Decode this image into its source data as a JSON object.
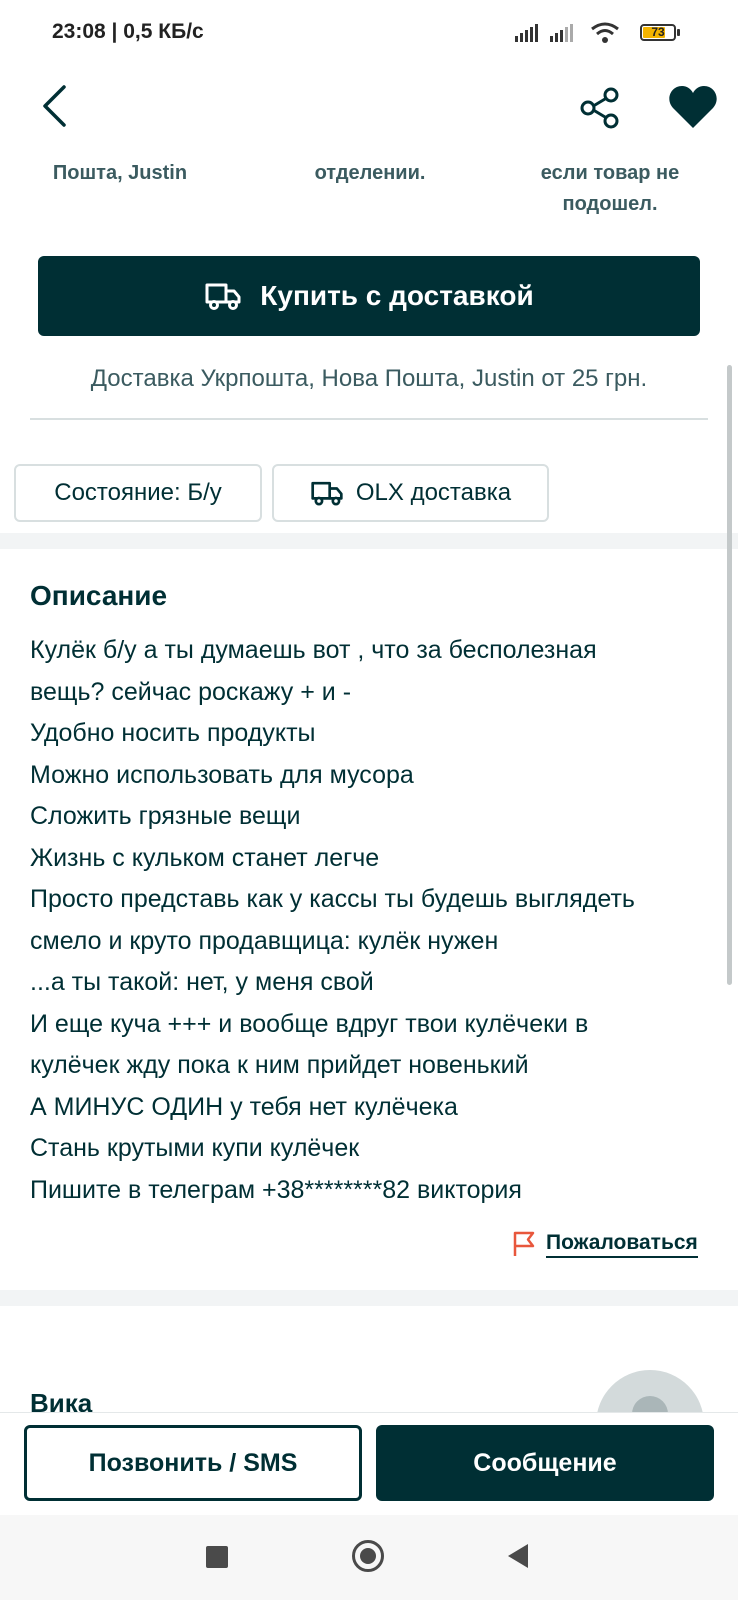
{
  "status_bar": {
    "time": "23:08 | 0,5 КБ/с",
    "battery": "73"
  },
  "header": {
    "back_icon": "chevron-left-icon",
    "share_icon": "share-icon",
    "favorite_icon": "heart-icon"
  },
  "delivery_info": [
    {
      "lines": [
        "Пошта, Justin"
      ]
    },
    {
      "lines": [
        "отделении."
      ]
    },
    {
      "lines": [
        "если товар не",
        "подошел."
      ]
    }
  ],
  "buy_button": {
    "label": "Купить с доставкой",
    "icon": "truck-icon"
  },
  "delivery_note": "Доставка Укрпошта, Нова Пошта, Justin от 25 грн.",
  "tags": {
    "condition": "Состояние: Б/у",
    "olx_delivery": "OLX доставка"
  },
  "description": {
    "title": "Описание",
    "lines": [
      "Кулёк б/у а ты думаешь вот , что за бесполезная",
      "вещь? сейчас роскажу + и -",
      "Удобно носить продукты",
      "Можно использовать для мусора",
      "Сложить грязные вещи",
      "Жизнь с кульком станет легче",
      "Просто представь как у кассы ты будешь выглядеть",
      "смело и круто продавщица: кулёк нужен",
      "...а ты такой: нет, у меня свой",
      "И еще куча +++ и вообще вдруг твои кулёчеки в",
      "кулёчек жду пока к ним прийдет новенький",
      "А МИНУС ОДИН у тебя нет кулёчека",
      "Стань крутыми купи кулёчек",
      "Пишите в телеграм +38********82 виктория"
    ]
  },
  "report": {
    "label": "Пожаловаться",
    "icon": "flag-icon"
  },
  "seller": {
    "name": "Вика"
  },
  "actions": {
    "call_label": "Позвонить / SMS",
    "message_label": "Сообщение"
  },
  "colors": {
    "primary": "#002f34",
    "accent_flag": "#e8573c",
    "divider": "#d8dfe0"
  }
}
